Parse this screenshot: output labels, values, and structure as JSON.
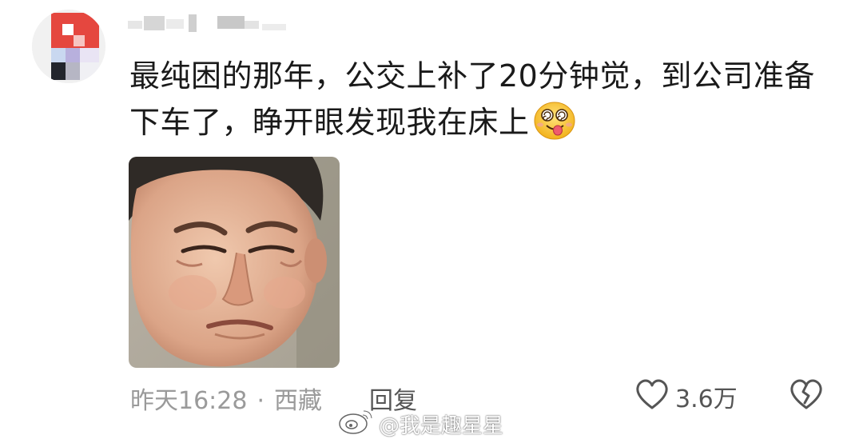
{
  "comment": {
    "line1": "最纯困的那年，公交上补了20分钟觉，到公司准备",
    "line2": "下车了，睁开眼发现我在床上",
    "emoji": "dizzy-tongue-face-emoji"
  },
  "meta": {
    "time": "昨天16:28",
    "separator": "·",
    "location": "西藏",
    "reply_label": "回复",
    "like_count": "3.6万"
  },
  "icons": {
    "like": "heart-outline-icon",
    "dislike": "broken-heart-icon",
    "watermark": "weibo-logo-icon"
  },
  "watermark": {
    "text": "@我是趣星星"
  },
  "colors": {
    "text_primary": "#1a1a1a",
    "text_meta": "#9a9a9a",
    "text_action": "#555555",
    "avatar_red": "#e5473f"
  }
}
